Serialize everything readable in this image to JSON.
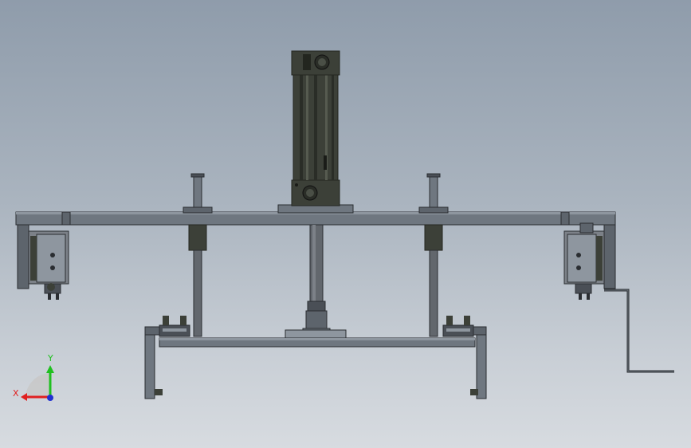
{
  "triad": {
    "x_label": "X",
    "y_label": "Y",
    "x_color": "#e02020",
    "y_color": "#20c020",
    "z_color": "#2030d0"
  },
  "colors": {
    "frame_fill": "#6f7780",
    "frame_dark": "#4a4f56",
    "frame_light": "#8e969f",
    "cylinder_body": "#3c4038",
    "cylinder_dark": "#23261f",
    "rod": "#62676d",
    "outline": "#2a2d31"
  }
}
